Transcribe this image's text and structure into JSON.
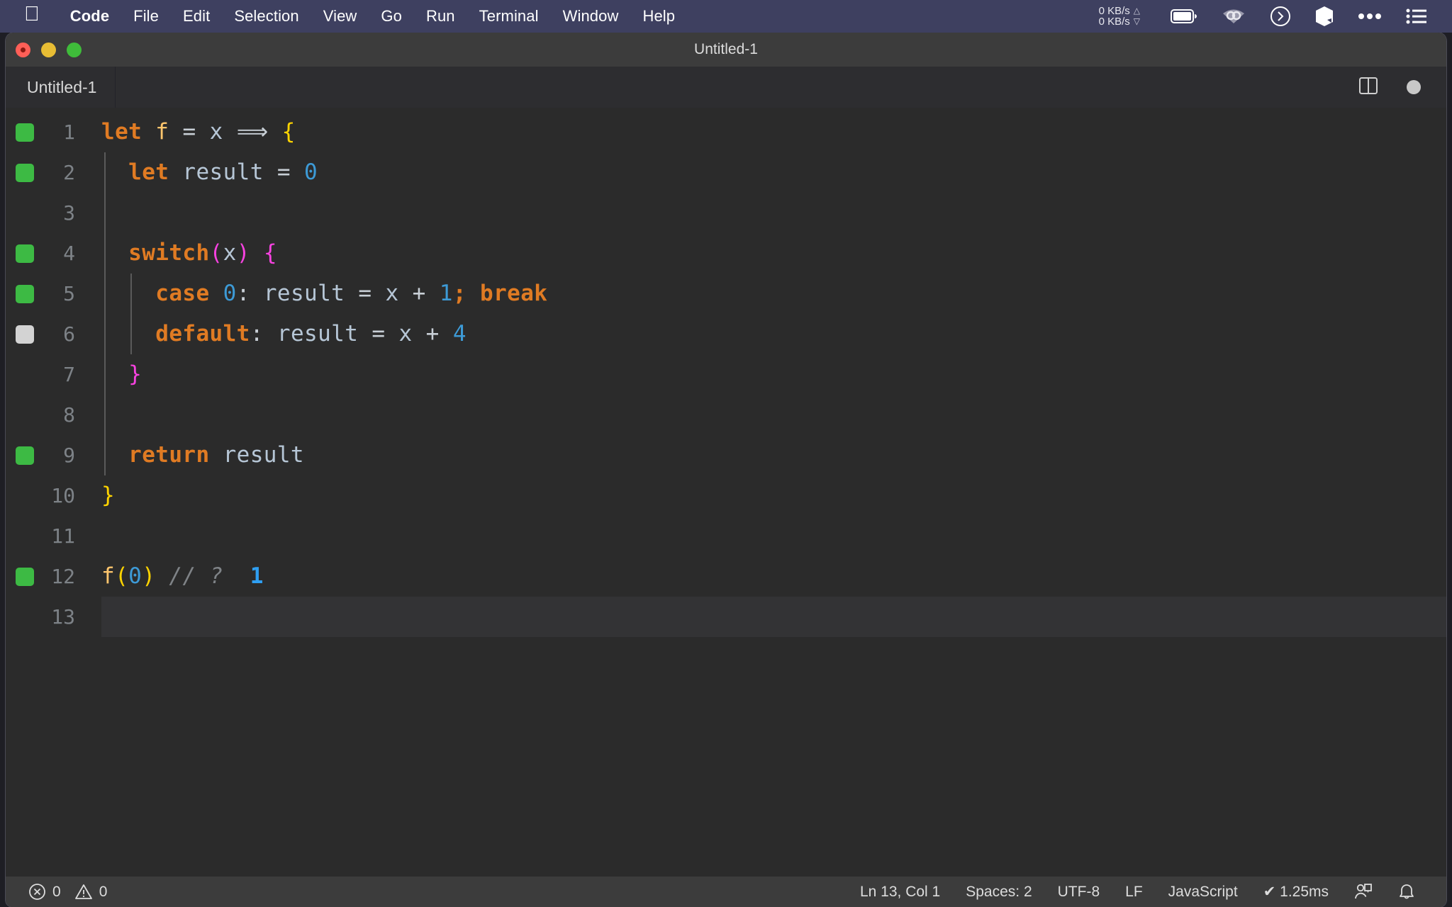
{
  "menubar": {
    "apple_icon": "apple-logo-icon",
    "items": [
      {
        "label": "Code",
        "bold": true
      },
      {
        "label": "File",
        "bold": false
      },
      {
        "label": "Edit",
        "bold": false
      },
      {
        "label": "Selection",
        "bold": false
      },
      {
        "label": "View",
        "bold": false
      },
      {
        "label": "Go",
        "bold": false
      },
      {
        "label": "Run",
        "bold": false
      },
      {
        "label": "Terminal",
        "bold": false
      },
      {
        "label": "Window",
        "bold": false
      },
      {
        "label": "Help",
        "bold": false
      }
    ],
    "network": {
      "upload": "0 KB/s",
      "download": "0 KB/s",
      "up_arrow": "△",
      "down_arrow": "▽"
    },
    "status_icons": [
      "battery-icon",
      "wifi-icon",
      "clock-icon",
      "shortcuts-icon",
      "ellipsis-icon",
      "control-center-icon"
    ]
  },
  "window": {
    "title": "Untitled-1",
    "traffic_lights": [
      "close-button",
      "minimize-button",
      "maximize-button"
    ]
  },
  "tabbar": {
    "active_tab": "Untitled-1",
    "actions": [
      "split-editor-icon",
      "unsaved-dot-indicator"
    ]
  },
  "editor": {
    "current_line": 13,
    "lines": [
      {
        "n": "1",
        "coverage": "covered",
        "indent_guides": 0,
        "tokens": [
          {
            "t": "let",
            "c": "kw"
          },
          {
            "t": " ",
            "c": "op"
          },
          {
            "t": "f",
            "c": "fn"
          },
          {
            "t": " ",
            "c": "op"
          },
          {
            "t": "=",
            "c": "op"
          },
          {
            "t": " ",
            "c": "op"
          },
          {
            "t": "x",
            "c": "var"
          },
          {
            "t": " ",
            "c": "op"
          },
          {
            "t": "⟹",
            "c": "op"
          },
          {
            "t": " ",
            "c": "op"
          },
          {
            "t": "{",
            "c": "br1"
          }
        ]
      },
      {
        "n": "2",
        "coverage": "covered",
        "indent_guides": 1,
        "tokens": [
          {
            "t": "  ",
            "c": "op"
          },
          {
            "t": "let",
            "c": "kw"
          },
          {
            "t": " ",
            "c": "op"
          },
          {
            "t": "result",
            "c": "var"
          },
          {
            "t": " ",
            "c": "op"
          },
          {
            "t": "=",
            "c": "op"
          },
          {
            "t": " ",
            "c": "op"
          },
          {
            "t": "0",
            "c": "num"
          }
        ]
      },
      {
        "n": "3",
        "coverage": "none",
        "indent_guides": 1,
        "tokens": []
      },
      {
        "n": "4",
        "coverage": "covered",
        "indent_guides": 1,
        "tokens": [
          {
            "t": "  ",
            "c": "op"
          },
          {
            "t": "switch",
            "c": "kw"
          },
          {
            "t": "(",
            "c": "br2"
          },
          {
            "t": "x",
            "c": "var"
          },
          {
            "t": ")",
            "c": "br2"
          },
          {
            "t": " ",
            "c": "op"
          },
          {
            "t": "{",
            "c": "br2"
          }
        ]
      },
      {
        "n": "5",
        "coverage": "covered",
        "indent_guides": 2,
        "tokens": [
          {
            "t": "    ",
            "c": "op"
          },
          {
            "t": "case",
            "c": "kw"
          },
          {
            "t": " ",
            "c": "op"
          },
          {
            "t": "0",
            "c": "num"
          },
          {
            "t": ":",
            "c": "op"
          },
          {
            "t": " ",
            "c": "op"
          },
          {
            "t": "result",
            "c": "var"
          },
          {
            "t": " ",
            "c": "op"
          },
          {
            "t": "=",
            "c": "op"
          },
          {
            "t": " ",
            "c": "op"
          },
          {
            "t": "x",
            "c": "var"
          },
          {
            "t": " ",
            "c": "op"
          },
          {
            "t": "+",
            "c": "op"
          },
          {
            "t": " ",
            "c": "op"
          },
          {
            "t": "1",
            "c": "num"
          },
          {
            "t": ";",
            "c": "punc"
          },
          {
            "t": " ",
            "c": "op"
          },
          {
            "t": "break",
            "c": "kw"
          }
        ]
      },
      {
        "n": "6",
        "coverage": "uncovered",
        "indent_guides": 2,
        "tokens": [
          {
            "t": "    ",
            "c": "op"
          },
          {
            "t": "default",
            "c": "kw"
          },
          {
            "t": ":",
            "c": "op"
          },
          {
            "t": " ",
            "c": "op"
          },
          {
            "t": "result",
            "c": "var"
          },
          {
            "t": " ",
            "c": "op"
          },
          {
            "t": "=",
            "c": "op"
          },
          {
            "t": " ",
            "c": "op"
          },
          {
            "t": "x",
            "c": "var"
          },
          {
            "t": " ",
            "c": "op"
          },
          {
            "t": "+",
            "c": "op"
          },
          {
            "t": " ",
            "c": "op"
          },
          {
            "t": "4",
            "c": "num"
          }
        ]
      },
      {
        "n": "7",
        "coverage": "none",
        "indent_guides": 1,
        "tokens": [
          {
            "t": "  ",
            "c": "op"
          },
          {
            "t": "}",
            "c": "br2"
          }
        ]
      },
      {
        "n": "8",
        "coverage": "none",
        "indent_guides": 1,
        "tokens": []
      },
      {
        "n": "9",
        "coverage": "covered",
        "indent_guides": 1,
        "tokens": [
          {
            "t": "  ",
            "c": "op"
          },
          {
            "t": "return",
            "c": "kw"
          },
          {
            "t": " ",
            "c": "op"
          },
          {
            "t": "result",
            "c": "var"
          }
        ]
      },
      {
        "n": "10",
        "coverage": "none",
        "indent_guides": 0,
        "tokens": [
          {
            "t": "}",
            "c": "br1"
          }
        ]
      },
      {
        "n": "11",
        "coverage": "none",
        "indent_guides": 0,
        "tokens": []
      },
      {
        "n": "12",
        "coverage": "covered",
        "indent_guides": 0,
        "tokens": [
          {
            "t": "f",
            "c": "fn"
          },
          {
            "t": "(",
            "c": "br1"
          },
          {
            "t": "0",
            "c": "num"
          },
          {
            "t": ")",
            "c": "br1"
          },
          {
            "t": " ",
            "c": "op"
          },
          {
            "t": "// ?",
            "c": "cmt"
          },
          {
            "t": "  ",
            "c": "op"
          },
          {
            "t": "1",
            "c": "inline-val"
          }
        ]
      },
      {
        "n": "13",
        "coverage": "none",
        "indent_guides": 0,
        "tokens": []
      }
    ]
  },
  "statusbar": {
    "error_icon": "error-circle-icon",
    "error_count": "0",
    "warning_icon": "warning-triangle-icon",
    "warning_count": "0",
    "cursor_position": "Ln 13, Col 1",
    "indentation": "Spaces: 2",
    "encoding": "UTF-8",
    "eol": "LF",
    "language": "JavaScript",
    "run_time": "✔ 1.25ms",
    "right_icons": [
      "remote-account-icon",
      "notifications-bell-icon"
    ]
  },
  "colors": {
    "menubar_bg": "#3e4060",
    "titlebar_bg": "#3c3c3c",
    "editor_bg": "#2b2b2b",
    "statusbar_bg": "#3c3c3c",
    "coverage_covered": "#3dba44",
    "coverage_uncovered": "#d3d3d3",
    "keyword": "#e07b23",
    "function": "#ffc66d",
    "variable": "#b6c6d6",
    "number": "#3d9ad6",
    "bracket_level1": "#ffd400",
    "bracket_level2": "#f742e0",
    "comment": "#7f8387",
    "inline_value": "#2f9ff2"
  }
}
